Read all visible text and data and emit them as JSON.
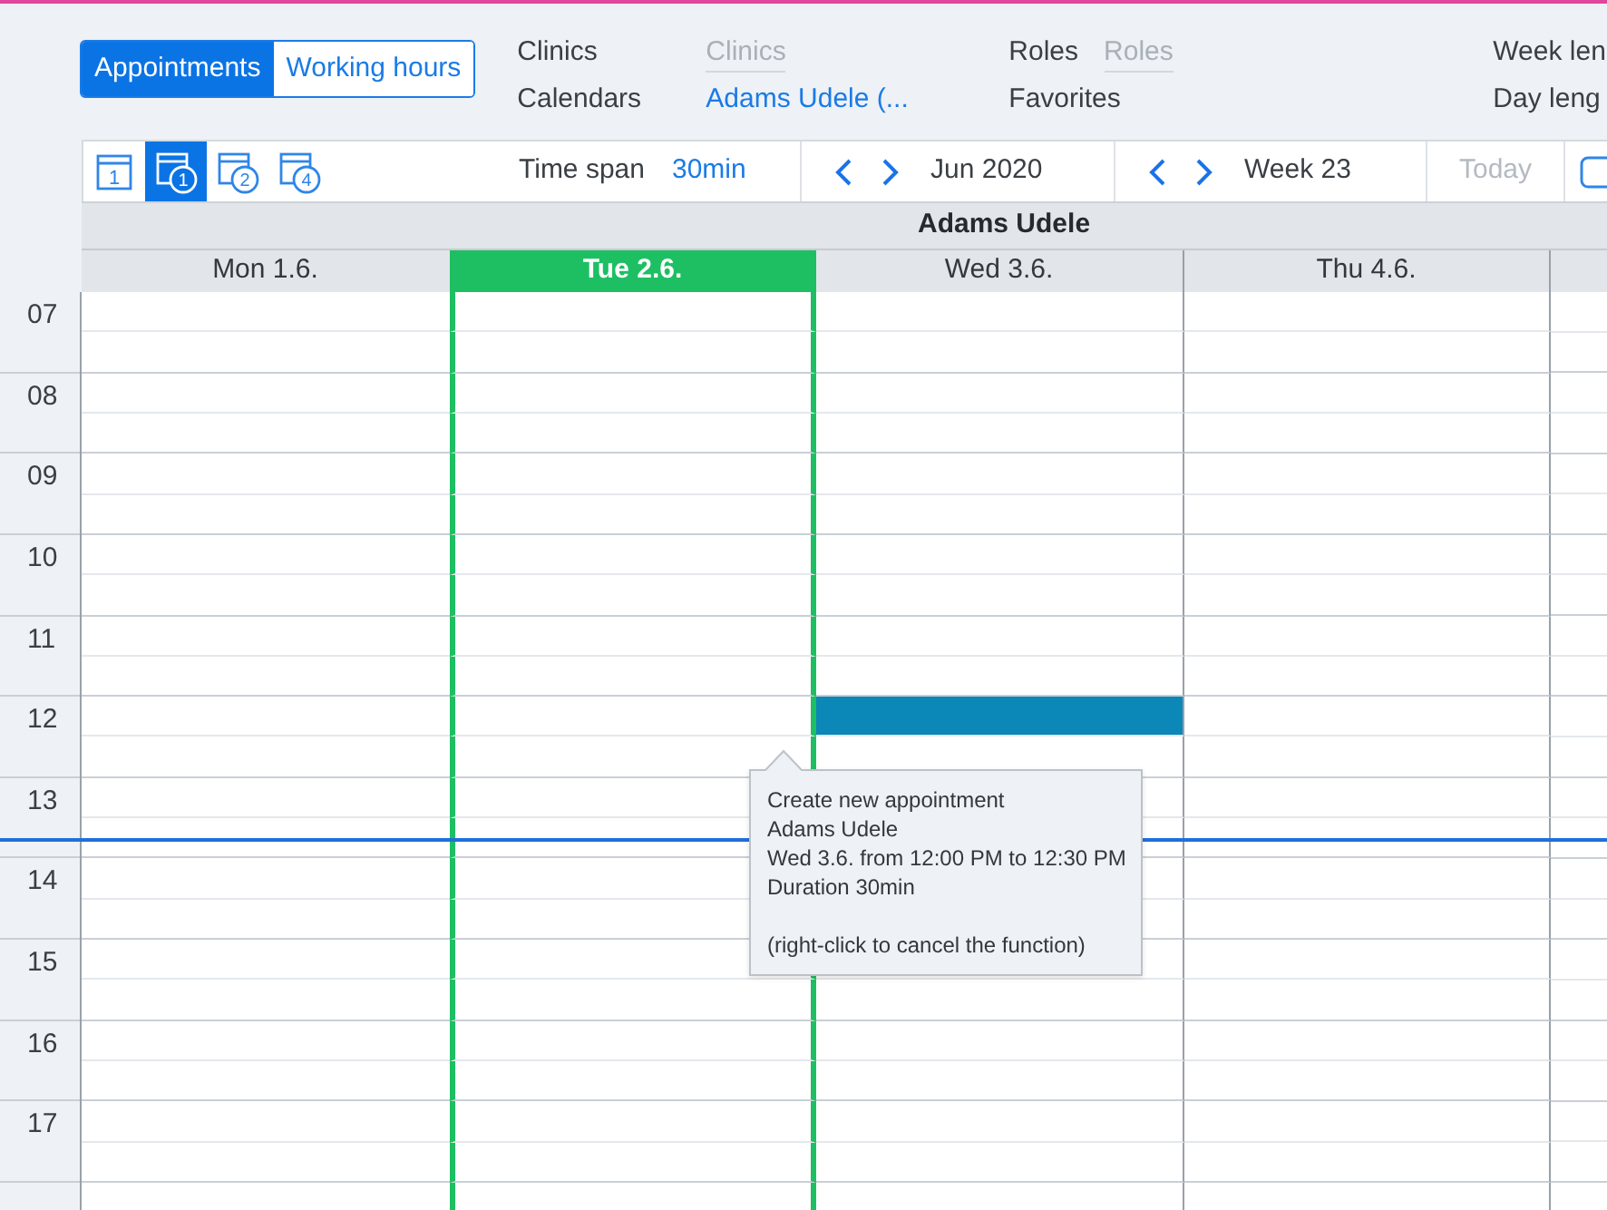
{
  "mode_tabs": [
    {
      "label": "Appointments",
      "selected": true
    },
    {
      "label": "Working hours",
      "selected": false
    }
  ],
  "filter_columns": [
    {
      "items": [
        {
          "label": "Clinics",
          "placeholder": "Clinics"
        },
        {
          "label": "Calendars",
          "value": "Adams Udele (..."
        }
      ]
    },
    {
      "items": [
        {
          "label": "Roles",
          "placeholder": "Roles"
        },
        {
          "label": "Favorites"
        }
      ]
    },
    {
      "items": [
        {
          "label": "Week len"
        },
        {
          "label": "Day leng"
        }
      ]
    }
  ],
  "toolbar": {
    "views": [
      {
        "kind": "day",
        "number": "1",
        "selected": false
      },
      {
        "kind": "week",
        "number": "1",
        "selected": true
      },
      {
        "kind": "week",
        "number": "2",
        "selected": false
      },
      {
        "kind": "week",
        "number": "4",
        "selected": false
      }
    ],
    "time_span": {
      "label": "Time span",
      "value": "30min"
    },
    "month": "Jun 2020",
    "week": "Week 23",
    "today": {
      "label": "Today",
      "disabled": true
    }
  },
  "calendar": {
    "resource": "Adams Udele",
    "days": [
      {
        "label": "Mon 1.6.",
        "selected": false
      },
      {
        "label": "Tue 2.6.",
        "selected": true
      },
      {
        "label": "Wed 3.6.",
        "selected": false
      },
      {
        "label": "Thu 4.6.",
        "selected": false
      }
    ],
    "rows": [
      {
        "label": "07",
        "current": false,
        "slots": [
          {
            "selected": false
          },
          {
            "selected": false
          },
          {
            "selected": false
          },
          {
            "selected": false
          }
        ]
      },
      {
        "current": false,
        "slots": [
          {
            "selected": false
          },
          {
            "selected": false
          },
          {
            "selected": false
          },
          {
            "selected": false
          }
        ]
      },
      {
        "label": "08",
        "current": false,
        "slots": [
          {
            "selected": false
          },
          {
            "selected": false
          },
          {
            "selected": false
          },
          {
            "selected": false
          }
        ]
      },
      {
        "current": false,
        "slots": [
          {
            "selected": false
          },
          {
            "selected": false
          },
          {
            "selected": false
          },
          {
            "selected": false
          }
        ]
      },
      {
        "label": "09",
        "current": false,
        "slots": [
          {
            "selected": false
          },
          {
            "selected": false
          },
          {
            "selected": false
          },
          {
            "selected": false
          }
        ]
      },
      {
        "current": false,
        "slots": [
          {
            "selected": false
          },
          {
            "selected": false
          },
          {
            "selected": false
          },
          {
            "selected": false
          }
        ]
      },
      {
        "label": "10",
        "current": false,
        "slots": [
          {
            "selected": false
          },
          {
            "selected": false
          },
          {
            "selected": false
          },
          {
            "selected": false
          }
        ]
      },
      {
        "current": false,
        "slots": [
          {
            "selected": false
          },
          {
            "selected": false
          },
          {
            "selected": false
          },
          {
            "selected": false
          }
        ]
      },
      {
        "label": "11",
        "current": false,
        "slots": [
          {
            "selected": false
          },
          {
            "selected": false
          },
          {
            "selected": false
          },
          {
            "selected": false
          }
        ]
      },
      {
        "current": false,
        "slots": [
          {
            "selected": false
          },
          {
            "selected": false
          },
          {
            "selected": false
          },
          {
            "selected": false
          }
        ]
      },
      {
        "label": "12",
        "current": false,
        "slots": [
          {
            "selected": false
          },
          {
            "selected": false
          },
          {
            "selected": true
          },
          {
            "selected": false
          }
        ]
      },
      {
        "current": false,
        "slots": [
          {
            "selected": false
          },
          {
            "selected": false
          },
          {
            "selected": false
          },
          {
            "selected": false
          }
        ]
      },
      {
        "label": "13",
        "current": false,
        "slots": [
          {
            "selected": false
          },
          {
            "selected": false
          },
          {
            "selected": false
          },
          {
            "selected": false
          }
        ]
      },
      {
        "current": true,
        "slots": [
          {
            "selected": false
          },
          {
            "selected": false
          },
          {
            "selected": false
          },
          {
            "selected": false
          }
        ]
      },
      {
        "label": "14",
        "current": false,
        "slots": [
          {
            "selected": false
          },
          {
            "selected": false
          },
          {
            "selected": false
          },
          {
            "selected": false
          }
        ]
      },
      {
        "current": false,
        "slots": [
          {
            "selected": false
          },
          {
            "selected": false
          },
          {
            "selected": false
          },
          {
            "selected": false
          }
        ]
      },
      {
        "label": "15",
        "current": false,
        "slots": [
          {
            "selected": false
          },
          {
            "selected": false
          },
          {
            "selected": false
          },
          {
            "selected": false
          }
        ]
      },
      {
        "current": false,
        "slots": [
          {
            "selected": false
          },
          {
            "selected": false
          },
          {
            "selected": false
          },
          {
            "selected": false
          }
        ]
      },
      {
        "label": "16",
        "current": false,
        "slots": [
          {
            "selected": false
          },
          {
            "selected": false
          },
          {
            "selected": false
          },
          {
            "selected": false
          }
        ]
      },
      {
        "current": false,
        "slots": [
          {
            "selected": false
          },
          {
            "selected": false
          },
          {
            "selected": false
          },
          {
            "selected": false
          }
        ]
      },
      {
        "label": "17",
        "current": false,
        "slots": [
          {
            "selected": false
          },
          {
            "selected": false
          },
          {
            "selected": false
          },
          {
            "selected": false
          }
        ]
      },
      {
        "current": false,
        "slots": [
          {
            "selected": false
          },
          {
            "selected": false
          },
          {
            "selected": false
          },
          {
            "selected": false
          }
        ]
      },
      {
        "current": false,
        "slots": [
          {
            "selected": false
          },
          {
            "selected": false
          },
          {
            "selected": false
          },
          {
            "selected": false
          }
        ]
      }
    ],
    "tooltip": {
      "title": "Create new appointment",
      "resource": "Adams Udele",
      "time": "Wed 3.6. from 12:00 PM to 12:30 PM",
      "duration": "Duration 30min",
      "hint": "(right-click to cancel the function)"
    }
  }
}
